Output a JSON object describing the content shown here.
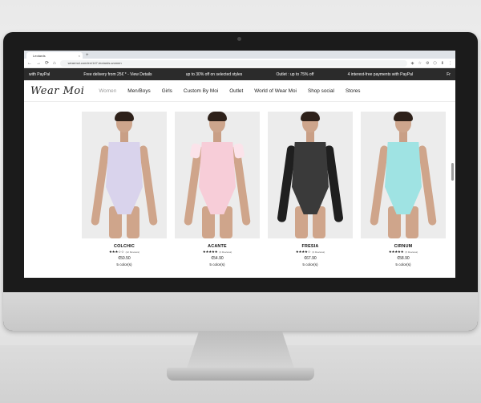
{
  "browser": {
    "tab_title": "Leotards",
    "tab_close": "×",
    "new_tab": "+",
    "url": "wearmoi.com/en/147-leotards-women",
    "nav_icons": [
      "←",
      "→",
      "⟳",
      "⌂"
    ],
    "toolbar_icons": [
      "◈",
      "☆",
      "⚙",
      "⬡",
      "⬇",
      "⋮"
    ]
  },
  "promo_bar": [
    "with PayPal",
    "Free delivery from 25€ * - View Details",
    "up to 30% off on selected styles",
    "Outlet : up to 75% off",
    "4 interest-free payments with PayPal",
    "Fr"
  ],
  "site": {
    "logo": "Wear Moi",
    "nav": [
      "Women",
      "Men/Boys",
      "Girls",
      "Custom By Moi",
      "Outlet",
      "World of Wear Moi",
      "Shop social",
      "Stores"
    ],
    "active_nav": "Women"
  },
  "products": [
    {
      "name": "COLCHIC",
      "stars": "★★★☆☆",
      "reviews": "(12 Reviews)",
      "price": "€50.50",
      "colors": "5 color(s)",
      "leotard_color": "#d9d3ec",
      "style": "camisole"
    },
    {
      "name": "ACANTE",
      "stars": "★★★★★",
      "reviews": "(3 Reviews)",
      "price": "€54.90",
      "colors": "5 color(s)",
      "leotard_color": "#f7cdd8",
      "style": "cap-sleeve"
    },
    {
      "name": "FRESIA",
      "stars": "★★★★☆",
      "reviews": "(9 Reviews)",
      "price": "€67.90",
      "colors": "5 color(s)",
      "leotard_color": "#3a3a3a",
      "style": "long-sleeve"
    },
    {
      "name": "CIRNUM",
      "stars": "★★★★★",
      "reviews": "(5 Reviews)",
      "price": "€58.90",
      "colors": "5 color(s)",
      "leotard_color": "#9fe3e3",
      "style": "camisole"
    }
  ]
}
